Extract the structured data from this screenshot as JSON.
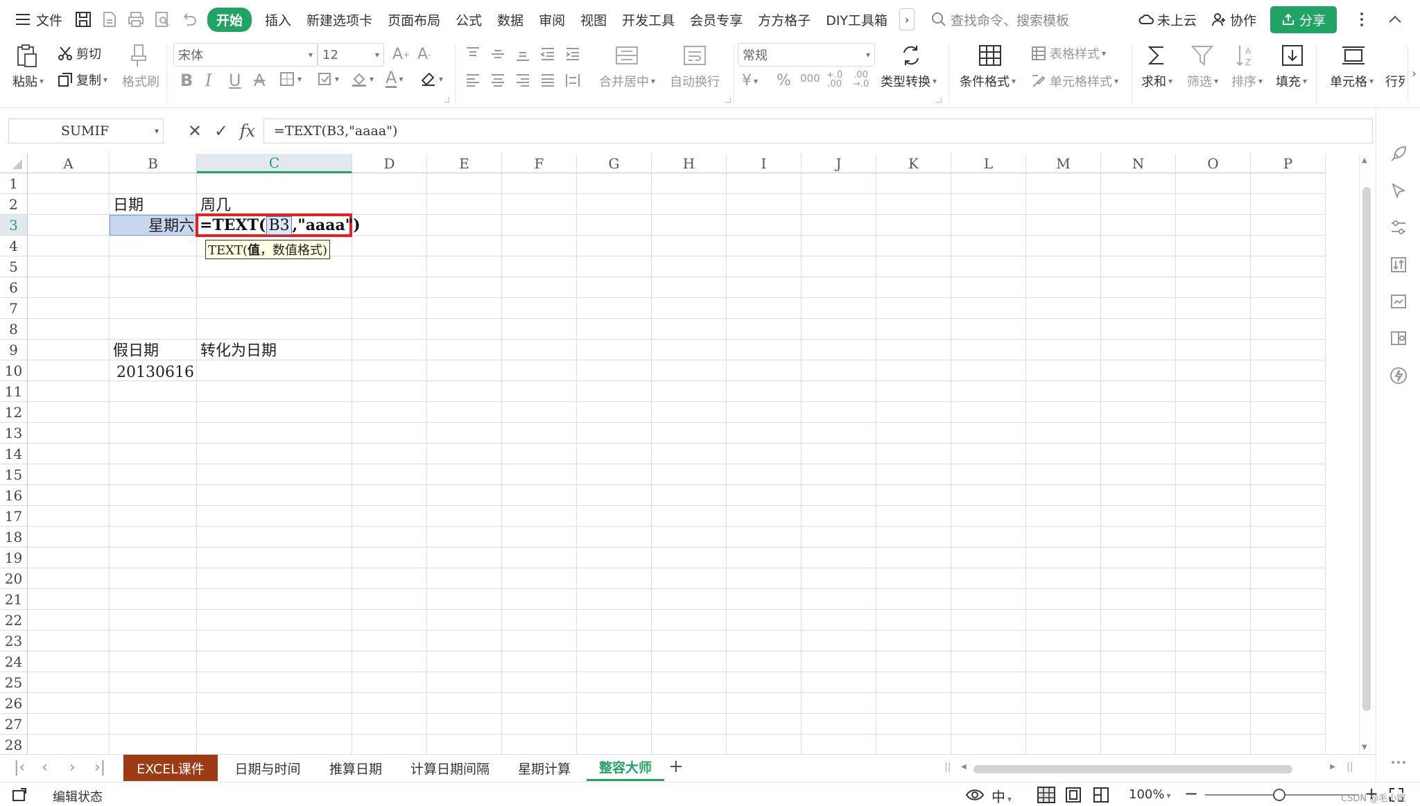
{
  "menu": {
    "file": "文件",
    "tabs": [
      "开始",
      "插入",
      "新建选项卡",
      "页面布局",
      "公式",
      "数据",
      "审阅",
      "视图",
      "开发工具",
      "会员专享",
      "方方格子",
      "DIY工具箱"
    ],
    "search_placeholder": "查找命令、搜索模板",
    "cloud": "未上云",
    "collab": "协作",
    "share": "分享"
  },
  "ribbon": {
    "paste": "粘贴",
    "cut": "剪切",
    "copy": "复制",
    "format_painter": "格式刷",
    "font_name": "宋体",
    "font_size": "12",
    "merge": "合并居中",
    "wrap": "自动换行",
    "number_format": "常规",
    "type_convert": "类型转换",
    "cond_format": "条件格式",
    "table_style": "表格样式",
    "cell_style": "单元格样式",
    "sum": "求和",
    "filter": "筛选",
    "sort": "排序",
    "fill": "填充",
    "cell": "单元格",
    "row_col": "行列"
  },
  "formula_bar": {
    "name_box": "SUMIF",
    "cancel": "✕",
    "confirm": "✓",
    "fx": "fx",
    "formula": "=TEXT(B3,\"aaaa\")"
  },
  "grid": {
    "columns": [
      "A",
      "B",
      "C",
      "D",
      "E",
      "F",
      "G",
      "H",
      "I",
      "J",
      "K",
      "L",
      "M",
      "N",
      "O",
      "P"
    ],
    "rows": [
      "1",
      "2",
      "3",
      "4",
      "5",
      "6",
      "7",
      "8",
      "9",
      "10",
      "11",
      "12",
      "13",
      "14",
      "15",
      "16",
      "17",
      "18",
      "19",
      "20",
      "21",
      "22",
      "23",
      "24",
      "25",
      "26",
      "27",
      "28"
    ],
    "cells": {
      "B2": "日期",
      "C2": "周几",
      "B3": "星期六",
      "B9": "假日期",
      "C9": "转化为日期",
      "B10": "20130616"
    },
    "edit": {
      "prefix": "=TEXT(",
      "ref": "B3",
      "suffix": ",\"aaaa\")"
    },
    "tooltip": {
      "fn": "TEXT",
      "open": "(",
      "arg1": "值",
      "rest": "，数值格式)"
    }
  },
  "sheets": [
    "EXCEL课件",
    "日期与时间",
    "推算日期",
    "计算日期间隔",
    "星期计算",
    "整容大师"
  ],
  "status": {
    "mode": "编辑状态",
    "zoom": "100%",
    "watermark": "CSDN @毛小妮"
  },
  "colors": {
    "accent": "#1fa463",
    "highlight_border": "#e5201f",
    "sheet_tab_brand": "#9c3b14",
    "selection": "#c9d7ee"
  }
}
